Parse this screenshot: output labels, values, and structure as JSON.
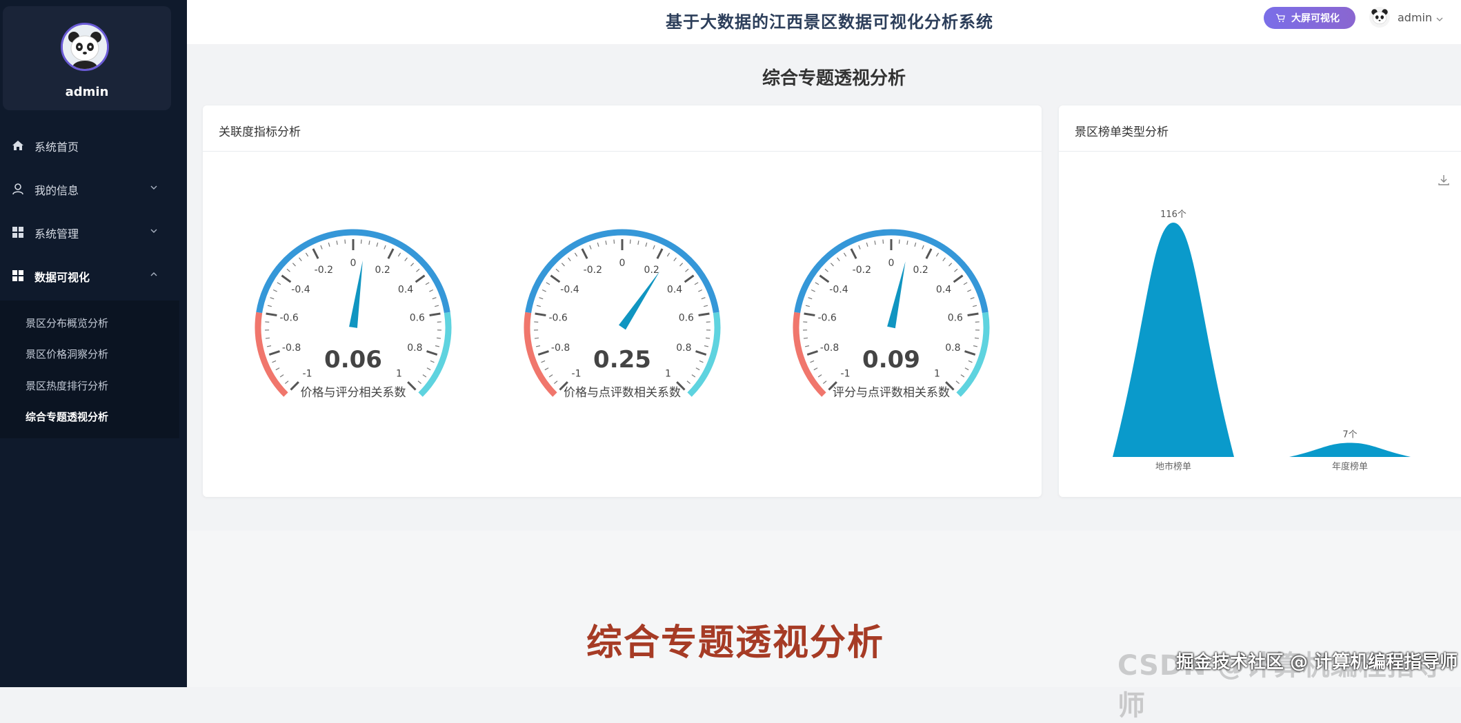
{
  "app": {
    "title": "基于大数据的江西景区数据可视化分析系统"
  },
  "header": {
    "bigscreen_label": "大屏可视化",
    "user": "admin"
  },
  "sidebar": {
    "profile_name": "admin",
    "items": [
      {
        "label": "系统首页",
        "icon": "home-icon"
      },
      {
        "label": "我的信息",
        "icon": "user-icon"
      },
      {
        "label": "系统管理",
        "icon": "grid-icon"
      },
      {
        "label": "数据可视化",
        "icon": "grid-icon"
      }
    ],
    "subitems": [
      "景区分布概览分析",
      "景区价格洞察分析",
      "景区热度排行分析",
      "综合专题透视分析"
    ],
    "current_subitem": 3
  },
  "main": {
    "page_title": "综合专题透视分析",
    "card1_title": "关联度指标分析",
    "card2_title": "景区榜单类型分析"
  },
  "chart_data": [
    {
      "type": "gauge",
      "min": -1,
      "max": 1,
      "tick_labels": [
        "-1",
        "-0.8",
        "-0.6",
        "-0.4",
        "-0.2",
        "0",
        "0.2",
        "0.4",
        "0.6",
        "0.8",
        "1"
      ],
      "band_colors": [
        "#f0766c",
        "#3597d8",
        "#5ed3df"
      ],
      "needle_color": "#1095c1",
      "gauges": [
        {
          "name": "价格与评分相关系数",
          "value": 0.06,
          "display": "0.06"
        },
        {
          "name": "价格与点评数相关系数",
          "value": 0.25,
          "display": "0.25"
        },
        {
          "name": "评分与点评数相关系数",
          "value": 0.09,
          "display": "0.09"
        }
      ]
    },
    {
      "type": "bar",
      "shape": "pictorial-triangle",
      "categories": [
        "地市榜单",
        "年度榜单"
      ],
      "values": [
        116,
        7
      ],
      "value_labels": [
        "116个",
        "7个"
      ],
      "color": "#0a9acb"
    }
  ],
  "overlay": {
    "caption": "综合专题透视分析",
    "watermark": "CSDN @计算机编程指导师",
    "credit": "掘金技术社区 @ 计算机编程指导师"
  }
}
